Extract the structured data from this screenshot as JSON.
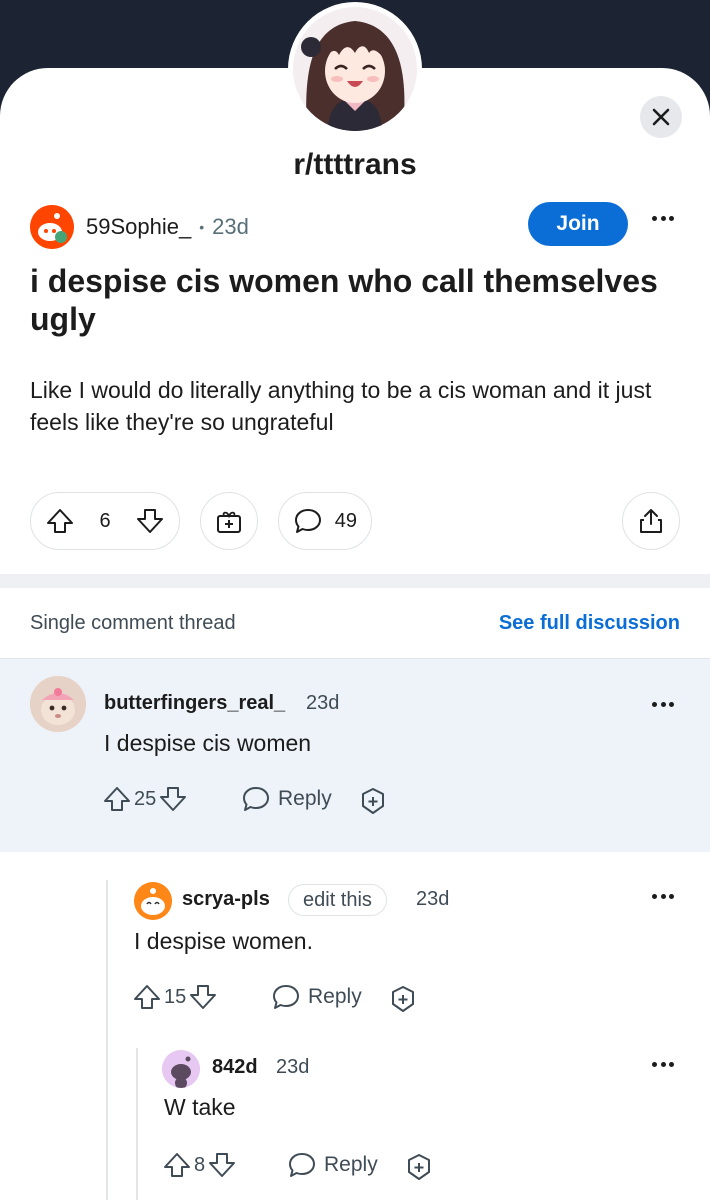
{
  "header": {
    "subreddit": "r/ttttrans"
  },
  "post": {
    "author": "59Sophie_",
    "separator": "•",
    "age": "23d",
    "join_label": "Join",
    "title": "i despise cis women who call themselves ugly",
    "body": "Like I would do literally anything to be a cis woman and it just feels like they're so ungrateful",
    "votes": "6",
    "comments": "49"
  },
  "thread": {
    "label": "Single comment thread",
    "see_full": "See full discussion"
  },
  "comments": [
    {
      "author": "butterfingers_real_",
      "age": "23d",
      "text": "I despise cis women",
      "votes": "25",
      "reply_label": "Reply"
    },
    {
      "author": "scrya-pls",
      "flair": "edit this",
      "age": "23d",
      "text": "I despise women.",
      "votes": "15",
      "reply_label": "Reply"
    },
    {
      "author": "842d",
      "age": "23d",
      "text": "W take",
      "votes": "8",
      "reply_label": "Reply"
    }
  ],
  "colors": {
    "accent": "#0a6ed6",
    "header_bg": "#1c2433",
    "highlight_bg": "#edf3f9",
    "snoo_orange": "#ff4500"
  },
  "icons": [
    "close-icon",
    "upvote-icon",
    "downvote-icon",
    "award-icon",
    "comment-icon",
    "share-icon",
    "more-icon"
  ]
}
